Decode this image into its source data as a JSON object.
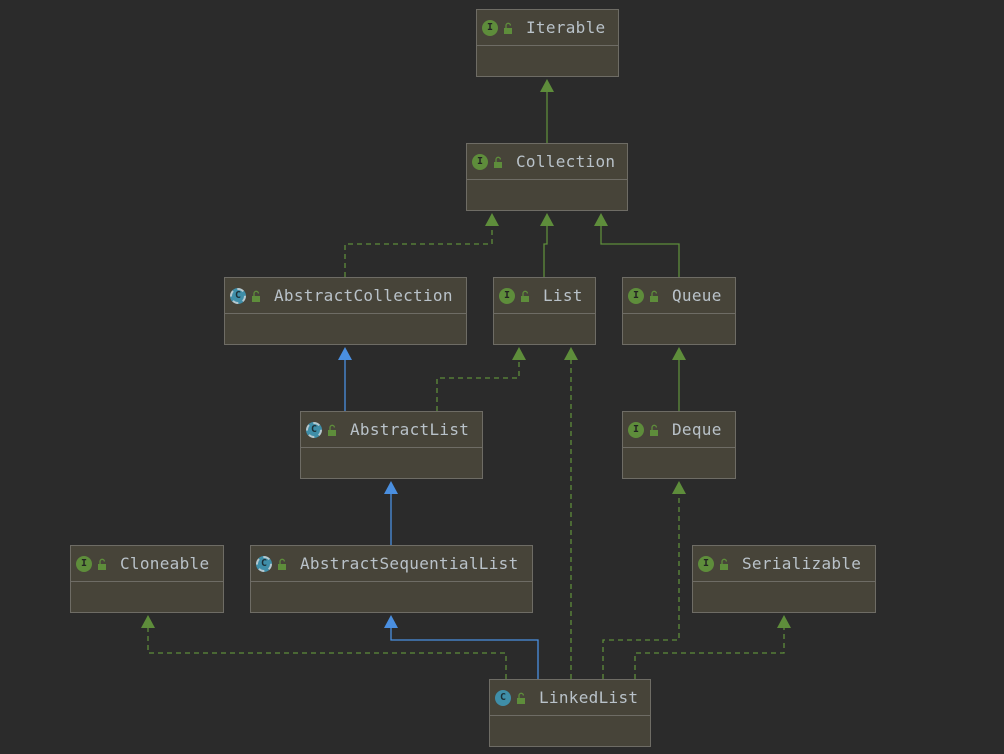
{
  "diagram": {
    "nodes": [
      {
        "id": "iterable",
        "label": "Iterable",
        "kind": "I"
      },
      {
        "id": "collection",
        "label": "Collection",
        "kind": "I"
      },
      {
        "id": "abstract-collection",
        "label": "AbstractCollection",
        "kind": "C"
      },
      {
        "id": "list",
        "label": "List",
        "kind": "I"
      },
      {
        "id": "queue",
        "label": "Queue",
        "kind": "I"
      },
      {
        "id": "abstract-list",
        "label": "AbstractList",
        "kind": "C"
      },
      {
        "id": "deque",
        "label": "Deque",
        "kind": "I"
      },
      {
        "id": "cloneable",
        "label": "Cloneable",
        "kind": "I"
      },
      {
        "id": "abstract-sequential-list",
        "label": "AbstractSequentialList",
        "kind": "C"
      },
      {
        "id": "serializable",
        "label": "Serializable",
        "kind": "I"
      },
      {
        "id": "linked-list",
        "label": "LinkedList",
        "kind": "C"
      }
    ],
    "edges": [
      {
        "from": "collection",
        "to": "iterable",
        "type": "extends"
      },
      {
        "from": "abstract-collection",
        "to": "collection",
        "type": "implements"
      },
      {
        "from": "list",
        "to": "collection",
        "type": "extends"
      },
      {
        "from": "queue",
        "to": "collection",
        "type": "extends"
      },
      {
        "from": "abstract-list",
        "to": "abstract-collection",
        "type": "class-extends"
      },
      {
        "from": "abstract-list",
        "to": "list",
        "type": "implements"
      },
      {
        "from": "deque",
        "to": "queue",
        "type": "extends"
      },
      {
        "from": "abstract-sequential-list",
        "to": "abstract-list",
        "type": "class-extends"
      },
      {
        "from": "linked-list",
        "to": "abstract-sequential-list",
        "type": "class-extends"
      },
      {
        "from": "linked-list",
        "to": "cloneable",
        "type": "implements"
      },
      {
        "from": "linked-list",
        "to": "list",
        "type": "implements"
      },
      {
        "from": "linked-list",
        "to": "deque",
        "type": "implements"
      },
      {
        "from": "linked-list",
        "to": "serializable",
        "type": "implements"
      }
    ]
  },
  "colors": {
    "background": "#2b2b2b",
    "node_fill": "#474439",
    "node_border": "#6e6c65",
    "interface_edge": "#5e8d3b",
    "class_edge": "#4a8fe0",
    "interface_badge": "#5e8d3b",
    "class_badge": "#3f8ea8",
    "label_text": "#b9c2c9"
  },
  "icons": {
    "interface": "interface-badge-icon",
    "class": "class-badge-icon",
    "abstract_class": "abstract-class-badge-icon",
    "visibility": "public-lock-icon"
  }
}
